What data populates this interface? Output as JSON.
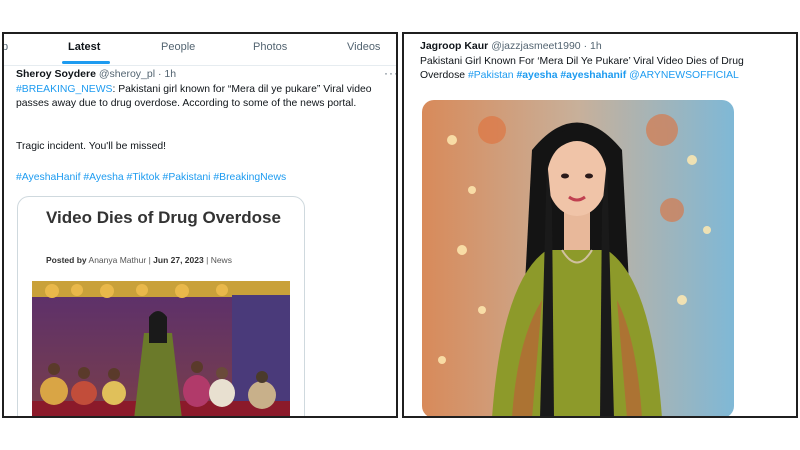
{
  "left": {
    "tabs": [
      {
        "label": "p"
      },
      {
        "label": "Latest"
      },
      {
        "label": "People"
      },
      {
        "label": "Photos"
      },
      {
        "label": "Videos"
      }
    ],
    "tweet": {
      "name": "Sheroy Soydere",
      "handle": "@sheroy_pl",
      "time": "· 1h",
      "hashtag_breaking": "#BREAKING_NEWS",
      "text_1": ": Pakistani girl known for “Mera dil ye pukare” Viral video passes away due to drug overdose. According to some of the news portal.",
      "text_2": "Tragic incident. You'll be missed!",
      "hashtags": [
        "#AyeshaHanif",
        "#Ayesha",
        "#Tiktok",
        "#Pakistani",
        "#BreakingNews"
      ]
    },
    "card": {
      "title": "Video Dies of Drug Overdose",
      "meta_posted_by": "Posted by",
      "meta_author": "Ananya Mathur",
      "meta_date": "Jun 27, 2023",
      "meta_category": "News",
      "meta_sep": "|"
    }
  },
  "right": {
    "tweet": {
      "name": "Jagroop Kaur",
      "handle": "@jazzjasmeet1990",
      "time": "· 1h",
      "text_1": "Pakistani Girl Known For ‘Mera Dil Ye Pukare’ Viral Video Dies of Drug",
      "text_2": "Overdose",
      "hashtags": [
        "#Pakistan",
        "#ayesha",
        "#ayeshahanif",
        "@ARYNEWSOFFICIAL"
      ]
    }
  },
  "colors": {
    "link": "#1d9bf0",
    "border": "#1f1f1f"
  },
  "icons": [
    "more-horizontal-icon"
  ]
}
